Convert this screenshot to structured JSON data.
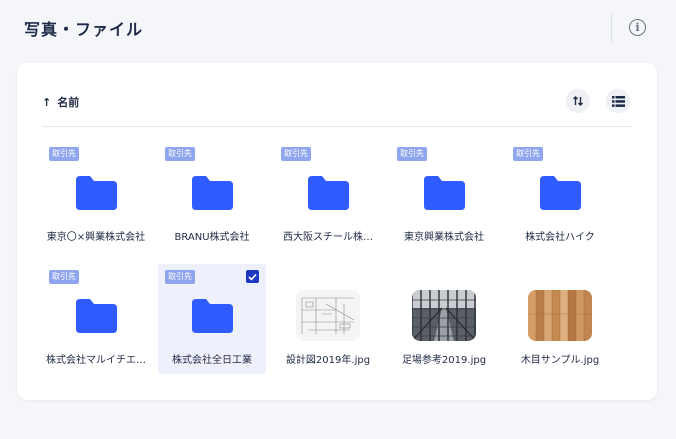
{
  "header": {
    "title": "写真・ファイル",
    "info_icon": "info-circle-icon"
  },
  "toolbar": {
    "sort_arrow": "↑",
    "sort_label": "名前",
    "sort_button_icon": "sort-swap-icon",
    "view_button_icon": "list-view-icon"
  },
  "colors": {
    "accent": "#2f5bff",
    "badge": "#8fa6ee",
    "selected_bg": "#eef1fc"
  },
  "items": [
    {
      "type": "folder",
      "badge": "取引先",
      "label": "東京〇×興業株式会社",
      "selected": false
    },
    {
      "type": "folder",
      "badge": "取引先",
      "label": "BRANU株式会社",
      "selected": false
    },
    {
      "type": "folder",
      "badge": "取引先",
      "label": "西大阪スチール株…",
      "selected": false
    },
    {
      "type": "folder",
      "badge": "取引先",
      "label": "東京興業株式会社",
      "selected": false
    },
    {
      "type": "folder",
      "badge": "取引先",
      "label": "株式会社ハイク",
      "selected": false
    },
    {
      "type": "folder",
      "badge": "取引先",
      "label": "株式会社マルイチエ…",
      "selected": false
    },
    {
      "type": "folder",
      "badge": "取引先",
      "label": "株式会社全日工業",
      "selected": true
    },
    {
      "type": "image",
      "thumb": "blueprint",
      "label": "設計図2019年.jpg",
      "selected": false
    },
    {
      "type": "image",
      "thumb": "scaffold",
      "label": "足場参考2019.jpg",
      "selected": false
    },
    {
      "type": "image",
      "thumb": "wood",
      "label": "木目サンプル.jpg",
      "selected": false
    }
  ]
}
